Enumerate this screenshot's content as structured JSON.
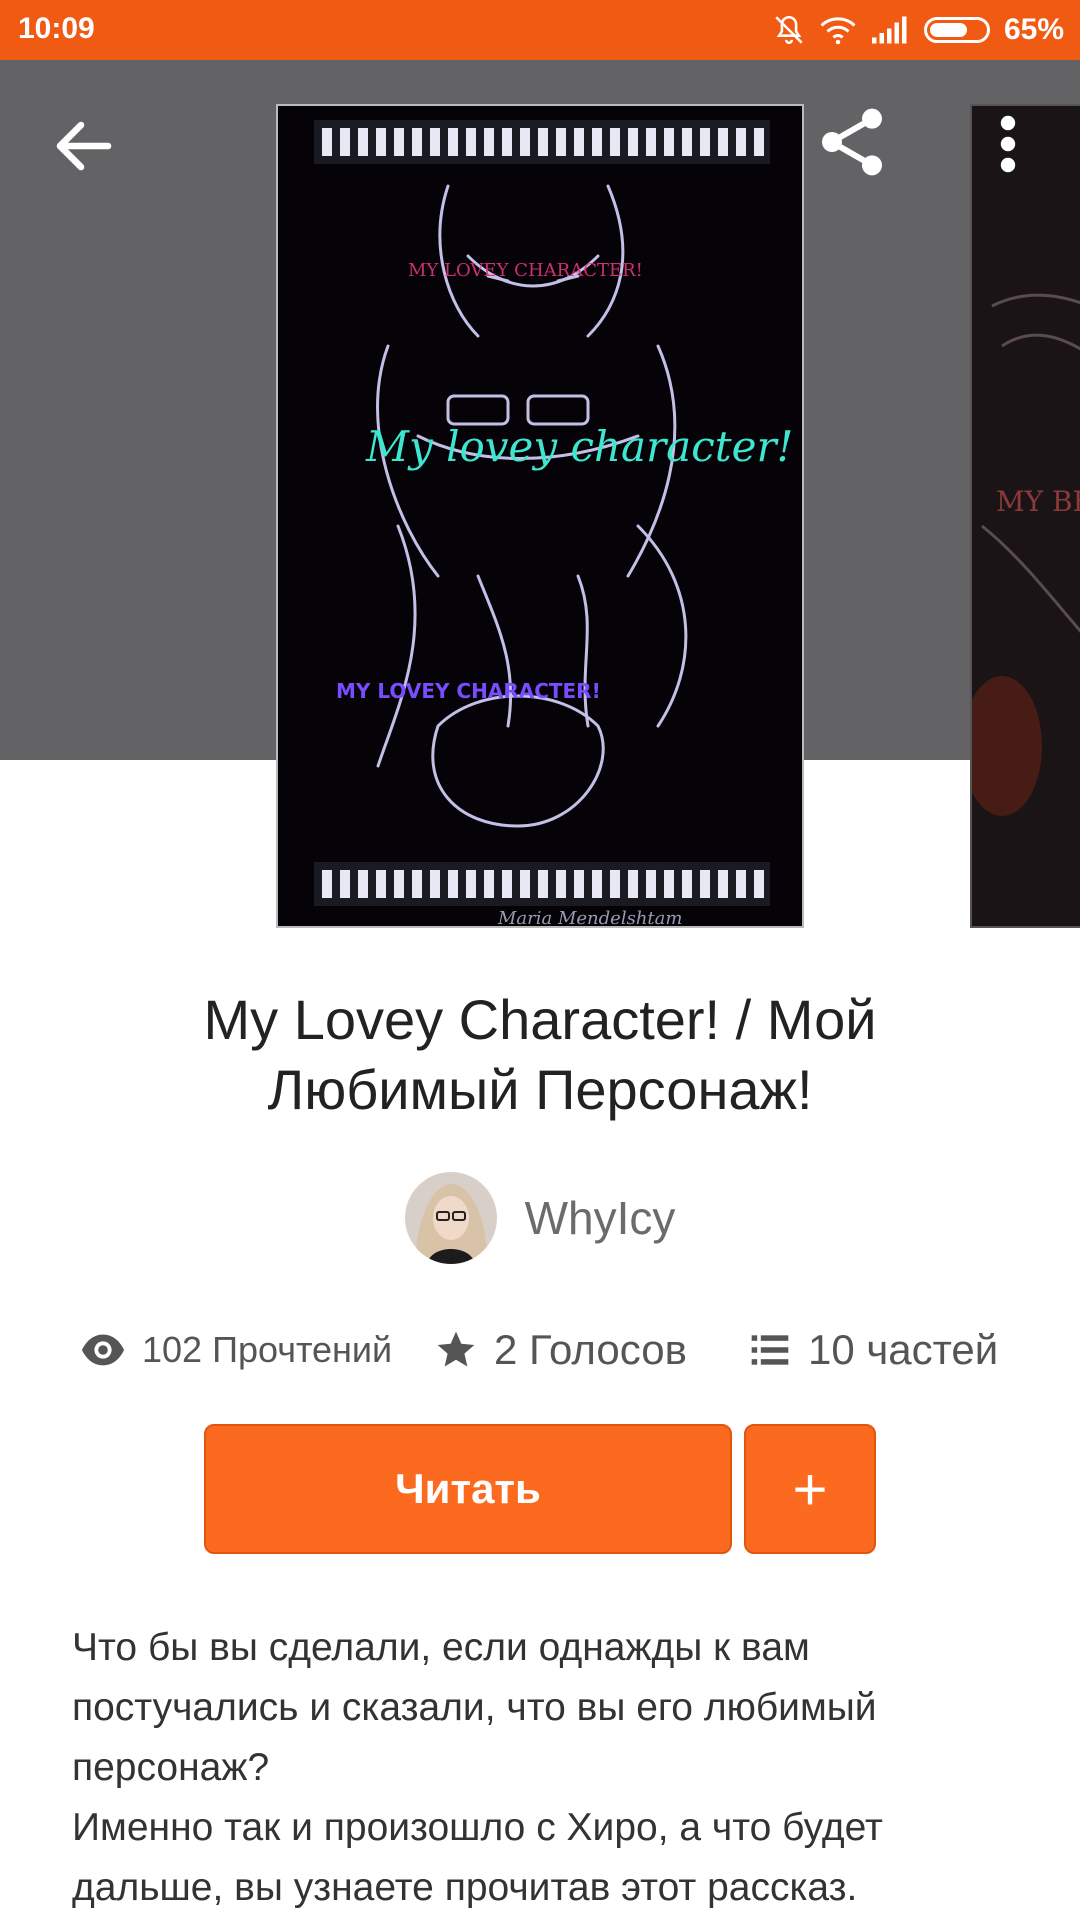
{
  "status_bar": {
    "time": "10:09",
    "battery": "65%"
  },
  "header": {
    "cover_art_text": "My lovey character!",
    "cover_signature": "Maria Mendelshtam",
    "next_cover_text": "MY BE"
  },
  "story": {
    "title": "My Lovey Character! / Мой Любимый Персонаж!",
    "author": "WhyIcy"
  },
  "stats": {
    "reads": "102 Прочтений",
    "votes": "2 Голосов",
    "parts": "10 частей"
  },
  "actions": {
    "read_label": "Читать",
    "add_label": "+"
  },
  "description": [
    "Что бы вы сделали, если однажды к вам постучались и сказали, что вы его любимый персонаж?",
    "Именно так и произошло с Хиро, а что будет дальше, вы узнаете прочитав этот рассказ."
  ],
  "colors": {
    "status_bar": "#f05a12",
    "header_bg": "#636365",
    "accent": "#fb6a1e"
  }
}
